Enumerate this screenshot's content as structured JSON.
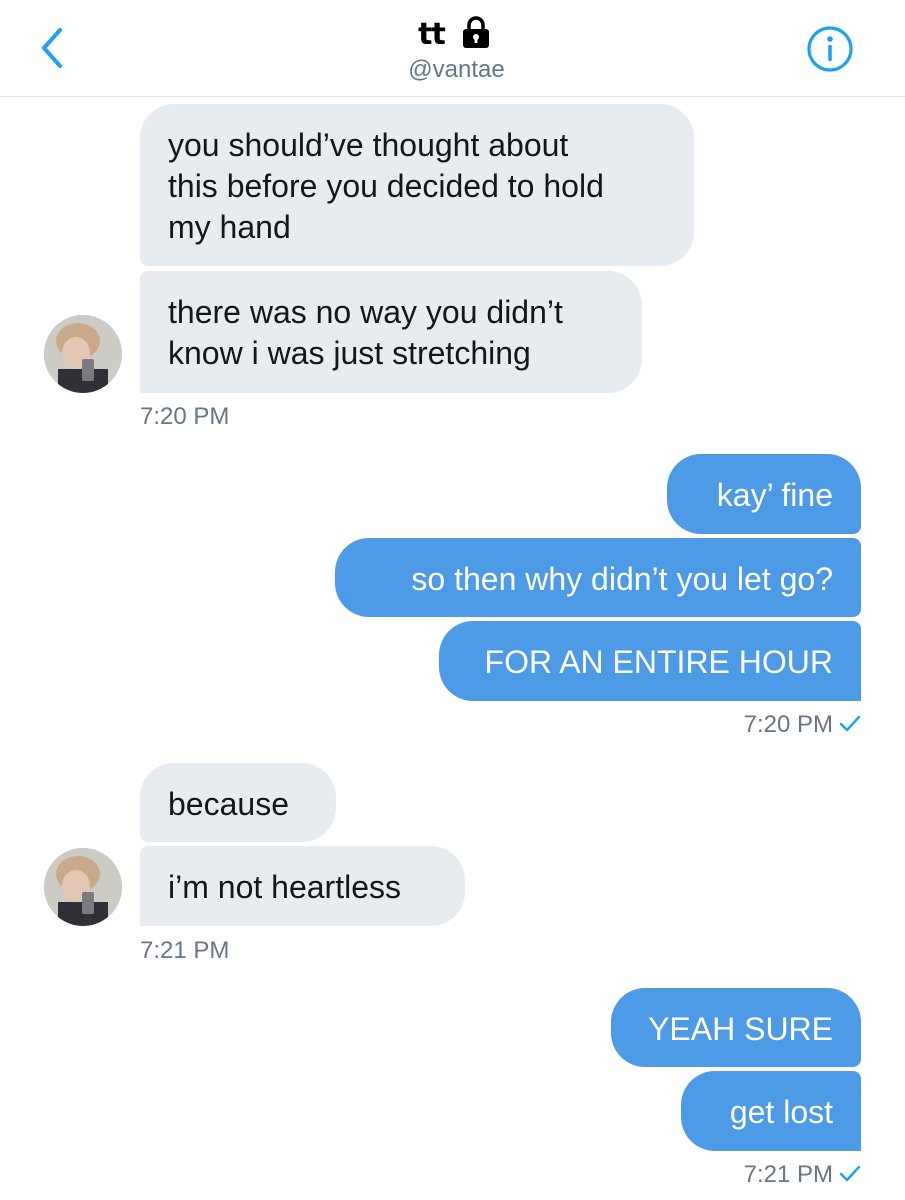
{
  "header": {
    "name": "tt",
    "handle": "@vantae",
    "back_icon": "chevron-left-icon",
    "lock_icon": "lock-icon",
    "info_icon": "info-circle-icon"
  },
  "colors": {
    "accent": "#1da1f2",
    "outgoing_bubble": "#4d9be6",
    "incoming_bubble": "#e6ecf0",
    "timestamp": "#657786"
  },
  "messages": {
    "g1": {
      "m1_line1": "you should’ve thought about",
      "m1_line2": "this before you decided to hold",
      "m1_line3": "my hand",
      "m2_line1": "there was no way you didn’t",
      "m2_line2": "know i was just stretching",
      "time": "7:20 PM"
    },
    "g2": {
      "m1": "kay’ fine",
      "m2": "so then why didn’t you let go?",
      "m3": "FOR AN ENTIRE HOUR",
      "time": "7:20 PM"
    },
    "g3": {
      "m1": "because",
      "m2": "i’m not heartless",
      "time": "7:21 PM"
    },
    "g4": {
      "m1": "YEAH SURE",
      "m2": "get lost",
      "time": "7:21 PM"
    }
  }
}
